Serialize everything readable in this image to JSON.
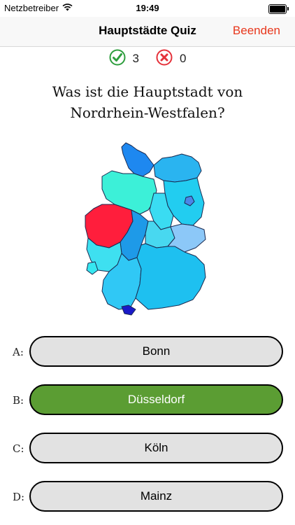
{
  "status": {
    "carrier": "Netzbetreiber",
    "time": "19:49",
    "battery_level": 1.0
  },
  "nav": {
    "title": "Hauptstädte Quiz",
    "end_label": "Beenden",
    "end_color": "#e8371c"
  },
  "score": {
    "correct_count": "3",
    "wrong_count": "0",
    "correct_color": "#2e9e3e",
    "wrong_color": "#e5313a"
  },
  "question": {
    "text": "Was ist die Hauptstadt von Nordrhein-Westfalen?"
  },
  "map": {
    "highlight_region": "Nordrhein-Westfalen",
    "highlight_color": "#ff1e3c"
  },
  "answers": [
    {
      "letter": "A:",
      "label": "Bonn",
      "state": "neutral"
    },
    {
      "letter": "B:",
      "label": "Düsseldorf",
      "state": "correct"
    },
    {
      "letter": "C:",
      "label": "Köln",
      "state": "neutral"
    },
    {
      "letter": "D:",
      "label": "Mainz",
      "state": "neutral"
    }
  ],
  "colors": {
    "answer_neutral": "#e2e2e2",
    "answer_correct": "#5b9d33"
  }
}
